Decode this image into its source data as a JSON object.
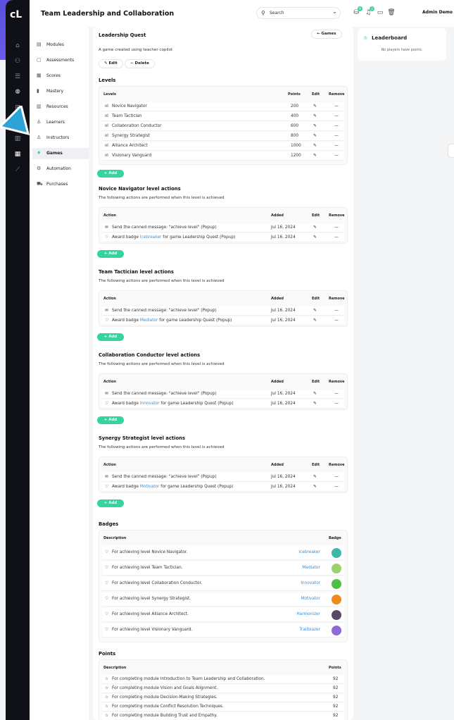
{
  "app": {
    "title": "Team Leadership and Collaboration",
    "logo": "cL"
  },
  "topbar": {
    "search_placeholder": "Search",
    "user": "Admin Demo",
    "badge_counts": [
      "9",
      "2"
    ]
  },
  "menu": [
    {
      "label": "Modules",
      "icon": "modules-icon"
    },
    {
      "label": "Assessments",
      "icon": "assessments-icon"
    },
    {
      "label": "Scores",
      "icon": "scores-icon"
    },
    {
      "label": "Mastery",
      "icon": "mastery-icon"
    },
    {
      "label": "Resources",
      "icon": "resources-icon"
    },
    {
      "label": "Learners",
      "icon": "learners-icon"
    },
    {
      "label": "Instructors",
      "icon": "instructors-icon"
    },
    {
      "label": "Games",
      "icon": "games-icon"
    },
    {
      "label": "Automation",
      "icon": "automation-icon"
    },
    {
      "label": "Purchases",
      "icon": "purchases-icon"
    }
  ],
  "game": {
    "title": "Leadership Quest",
    "back": "Games",
    "description": "A game created using teacher copilot",
    "edit": "Edit",
    "delete": "Delete"
  },
  "levels": {
    "heading": "Levels",
    "columns": [
      "Levels",
      "Points",
      "Edit",
      "Remove"
    ],
    "rows": [
      {
        "name": "Novice Navigator",
        "points": "200"
      },
      {
        "name": "Team Tactician",
        "points": "400"
      },
      {
        "name": "Collaboration Conductor",
        "points": "600"
      },
      {
        "name": "Synergy Strategist",
        "points": "800"
      },
      {
        "name": "Alliance Architect",
        "points": "1000"
      },
      {
        "name": "Visionary Vanguard",
        "points": "1200"
      }
    ]
  },
  "add_label": "+ Add",
  "action_columns": [
    "Action",
    "Added",
    "Edit",
    "Remove"
  ],
  "action_subtitle": "The following actions are performed when this level is achieved",
  "level_actions": [
    {
      "title": "Novice Navigator level actions",
      "msg": "Send the canned message: \"achieve level\" (Popup)",
      "award_pre": "Award badge ",
      "badge": "Icebreaker",
      "award_post": " for game Leadership Quest (Popup)",
      "date1": "Jul 16, 2024",
      "date2": "Jul 16, 2024"
    },
    {
      "title": "Team Tactician level actions",
      "msg": "Send the canned message: \"achieve level\" (Popup)",
      "award_pre": "Award badge ",
      "badge": "Mediator",
      "award_post": " for game Leadership Quest (Popup)",
      "date1": "Jul 16, 2024",
      "date2": "Jul 16, 2024"
    },
    {
      "title": "Collaboration Conductor level actions",
      "msg": "Send the canned message: \"achieve level\" (Popup)",
      "award_pre": "Award badge ",
      "badge": "Innovator",
      "award_post": " for game Leadership Quest (Popup)",
      "date1": "Jul 16, 2024",
      "date2": "Jul 16, 2024"
    },
    {
      "title": "Synergy Strategist level actions",
      "msg": "Send the canned message: \"achieve level\" (Popup)",
      "award_pre": "Award badge ",
      "badge": "Motivator",
      "award_post": " for game Leadership Quest (Popup)",
      "date1": "Jul 16, 2024",
      "date2": "Jul 16, 2024"
    }
  ],
  "badges": {
    "heading": "Badges",
    "columns": [
      "Description",
      "Badge"
    ],
    "rows": [
      {
        "desc": "For achieving level Novice Navigator.",
        "name": "Icebreaker",
        "color": "#3cb8a8"
      },
      {
        "desc": "For achieving level Team Tactician.",
        "name": "Mediator",
        "color": "#9bd36a"
      },
      {
        "desc": "For achieving level Collaboration Conductor.",
        "name": "Innovator",
        "color": "#4fbf45"
      },
      {
        "desc": "For achieving level Synergy Strategist.",
        "name": "Motivator",
        "color": "#f08a1c"
      },
      {
        "desc": "For achieving level Alliance Architect.",
        "name": "Harmonizer",
        "color": "#5a4a6a"
      },
      {
        "desc": "For achieving level Visionary Vanguard.",
        "name": "Trailblazer",
        "color": "#8c6bd6"
      }
    ]
  },
  "points": {
    "heading": "Points",
    "columns": [
      "Description",
      "Points"
    ],
    "rows": [
      {
        "desc": "For completing module Introduction to Team Leadership and Collaboration.",
        "pts": "92"
      },
      {
        "desc": "For completing module Vision and Goals Alignment.",
        "pts": "92"
      },
      {
        "desc": "For completing module Decision-Making Strategies.",
        "pts": "92"
      },
      {
        "desc": "For completing module Conflict Resolution Techniques.",
        "pts": "92"
      },
      {
        "desc": "For completing module Building Trust and Empathy.",
        "pts": "92"
      }
    ]
  },
  "leaderboard": {
    "title": "Leaderboard",
    "empty": "No players have points."
  }
}
